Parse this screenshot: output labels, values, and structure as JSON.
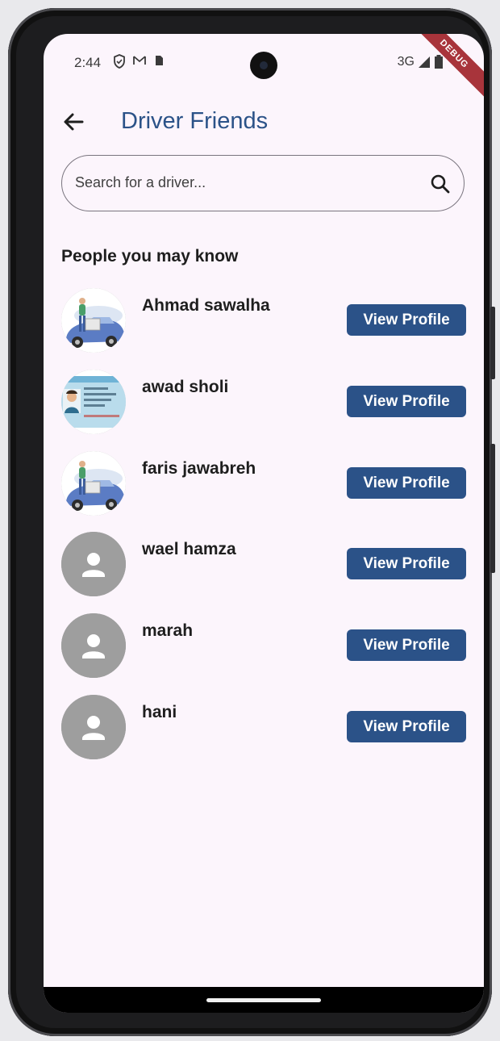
{
  "status_bar": {
    "time": "2:44",
    "network": "3G",
    "debug_banner": "DEBUG",
    "icons": [
      "shield-icon",
      "gmail-icon",
      "sim-card-icon",
      "signal-icon",
      "battery-icon"
    ]
  },
  "app_bar": {
    "title": "Driver Friends",
    "back_icon": "arrow-back-icon",
    "title_color": "#2b5288"
  },
  "search": {
    "placeholder": "Search for a driver...",
    "icon": "search-icon"
  },
  "section": {
    "title": "People you may know"
  },
  "people": [
    {
      "name": "Ahmad sawalha",
      "avatar": "car-illustration",
      "button": "View Profile"
    },
    {
      "name": "awad sholi",
      "avatar": "license-card",
      "button": "View Profile"
    },
    {
      "name": "faris jawabreh",
      "avatar": "car-illustration",
      "button": "View Profile"
    },
    {
      "name": "wael hamza",
      "avatar": "default-person",
      "button": "View Profile"
    },
    {
      "name": "marah",
      "avatar": "default-person",
      "button": "View Profile"
    },
    {
      "name": "hani",
      "avatar": "default-person",
      "button": "View Profile"
    }
  ],
  "colors": {
    "accent": "#2b5288",
    "background": "#fcf5fc",
    "default_avatar": "#9e9e9e"
  }
}
